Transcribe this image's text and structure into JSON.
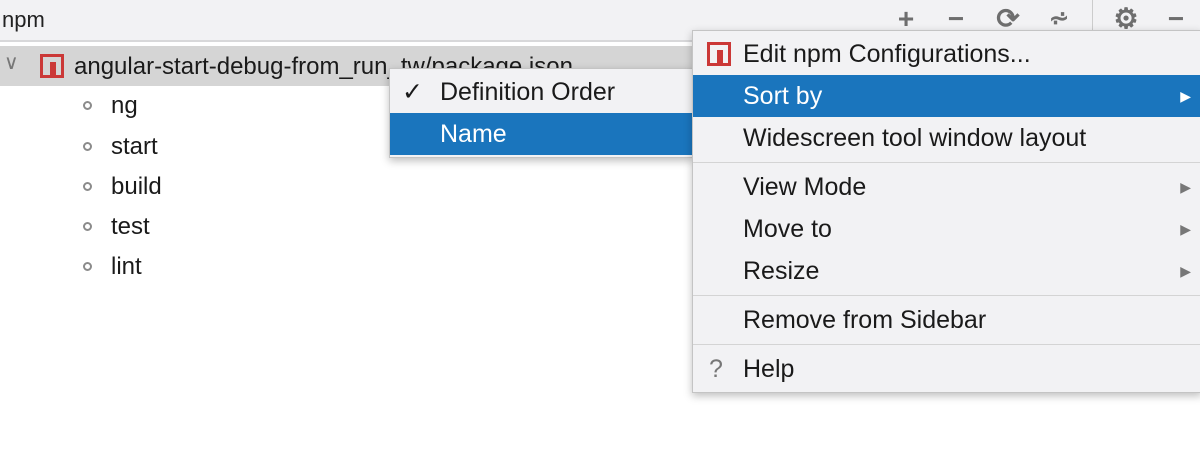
{
  "toolbar": {
    "title": "npm",
    "icons": [
      "add-icon",
      "remove-icon",
      "refresh-icon",
      "collapse-icon",
      "gear-icon",
      "minimize-icon"
    ]
  },
  "tree": {
    "root": "angular-start-debug-from_run_tw/package.json",
    "scripts": [
      "ng",
      "start",
      "build",
      "test",
      "lint"
    ]
  },
  "submenu": {
    "items": [
      {
        "label": "Definition Order",
        "checked": true
      },
      {
        "label": "Name",
        "selected": true
      }
    ]
  },
  "menu": {
    "edit": "Edit npm Configurations...",
    "sort_by": "Sort by",
    "widescreen": "Widescreen tool window layout",
    "view_mode": "View Mode",
    "move_to": "Move to",
    "resize": "Resize",
    "remove": "Remove from Sidebar",
    "help": "Help"
  },
  "colors": {
    "accent": "#1a75bd",
    "npm": "#cb3837"
  }
}
